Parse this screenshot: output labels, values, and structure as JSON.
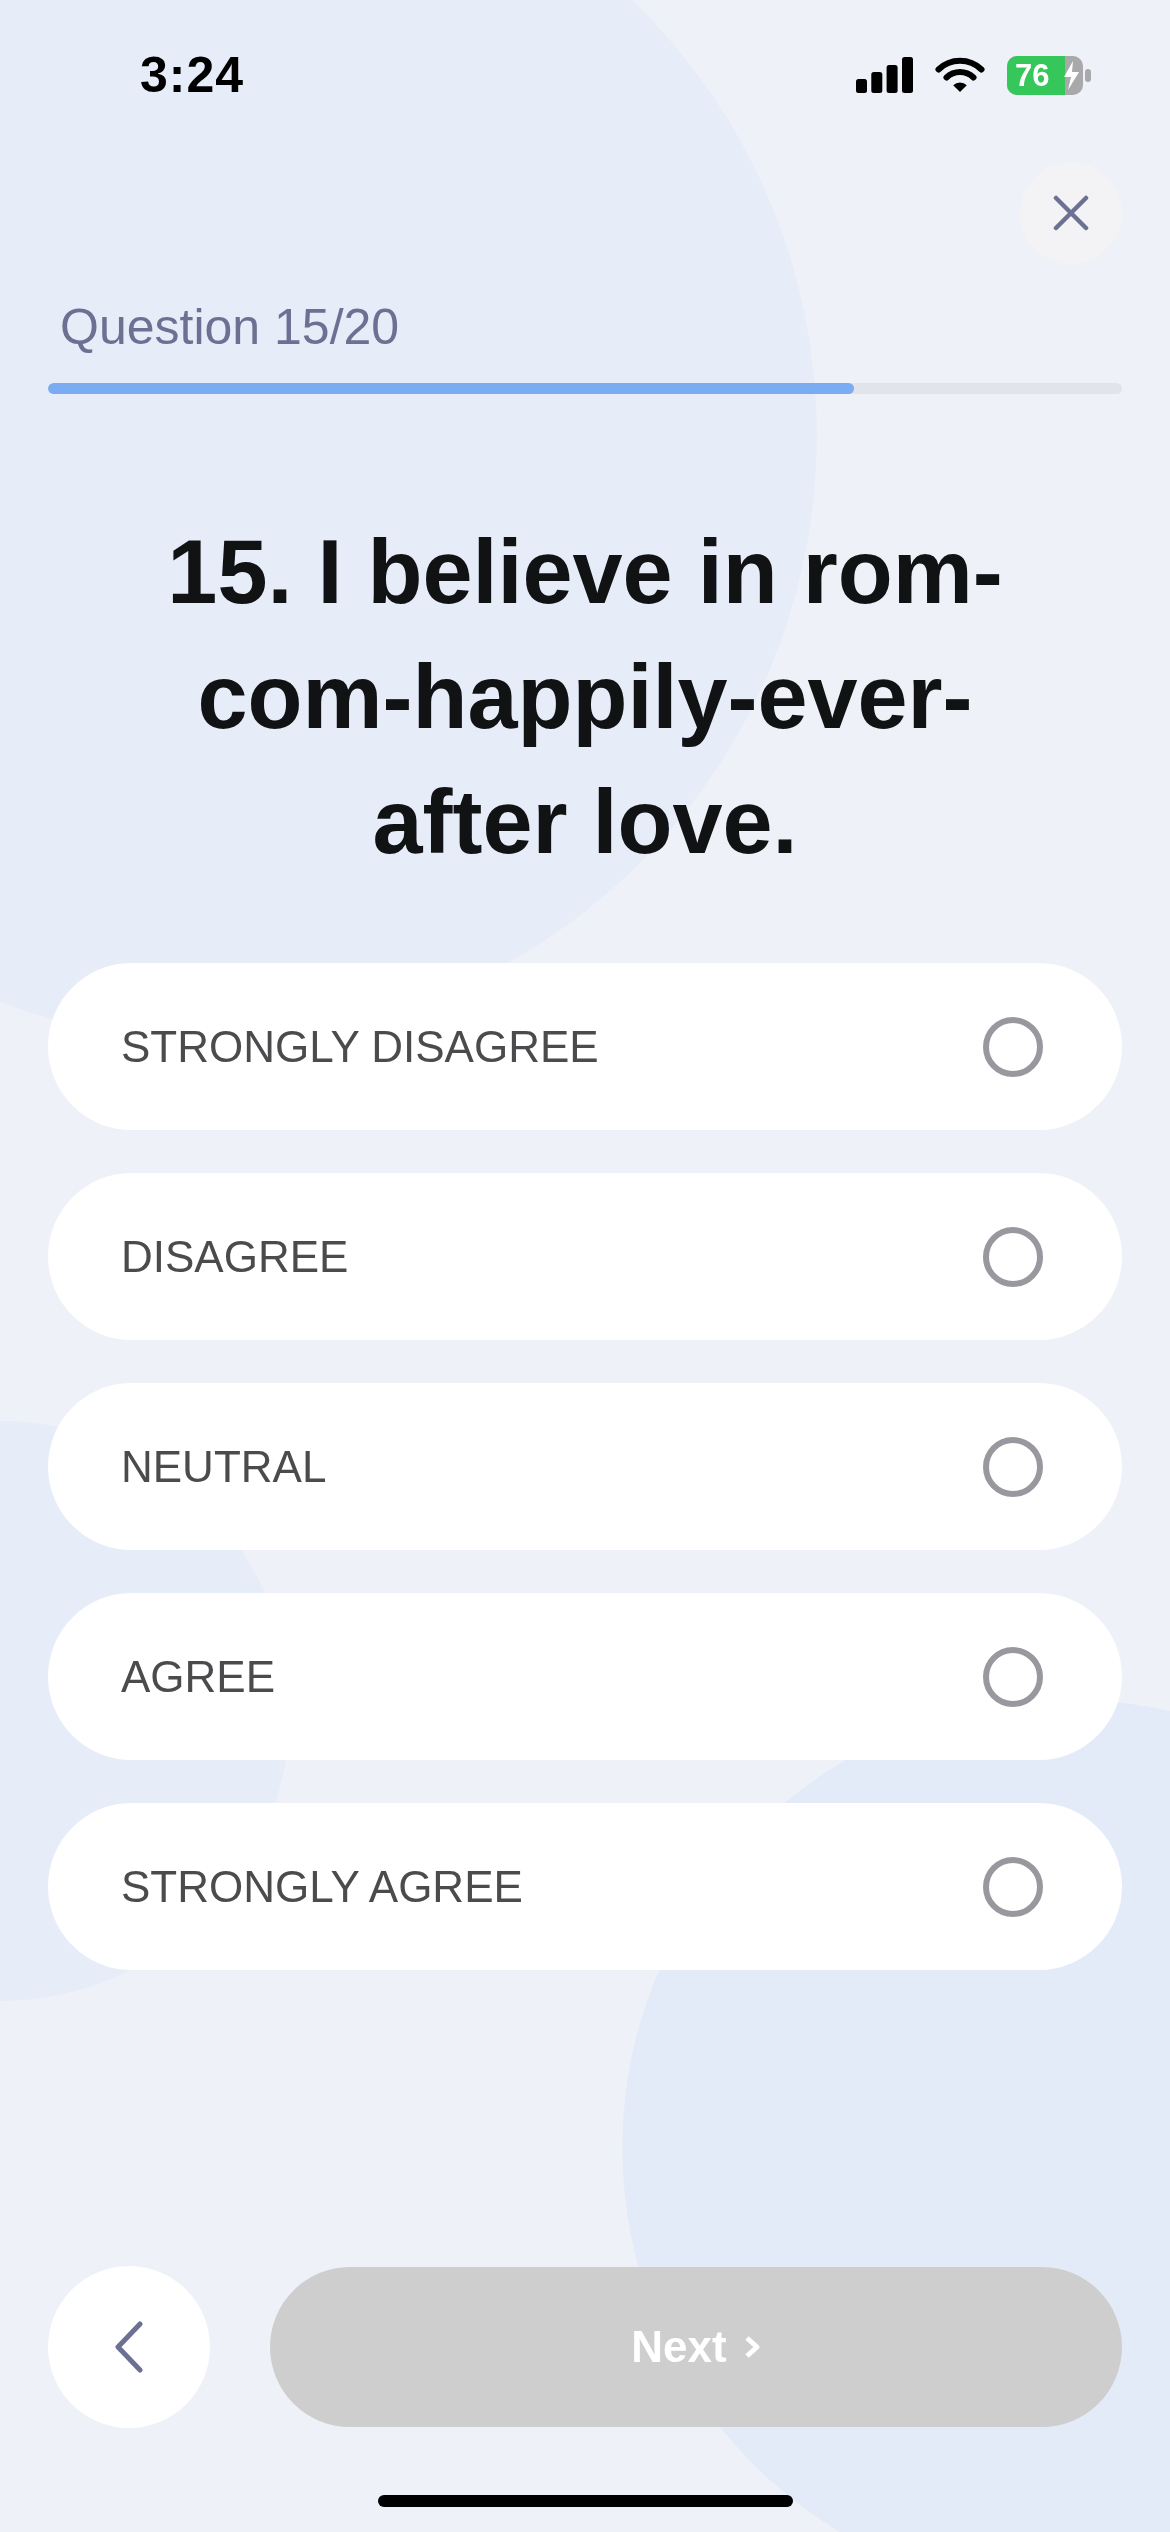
{
  "status_bar": {
    "time": "3:24",
    "battery": "76"
  },
  "header": {
    "progress_label": "Question 15/20",
    "progress": {
      "level": 0.75
    }
  },
  "question": {
    "text": "15. I believe in rom-com-happily-ever-after love."
  },
  "options": [
    {
      "label": "STRONGLY DISAGREE",
      "selected": false
    },
    {
      "label": "DISAGREE",
      "selected": false
    },
    {
      "label": "NEUTRAL",
      "selected": false
    },
    {
      "label": "AGREE",
      "selected": false
    },
    {
      "label": "STRONGLY AGREE",
      "selected": false
    }
  ],
  "footer": {
    "next_button": {
      "label": "Next",
      "disabled": true
    }
  }
}
